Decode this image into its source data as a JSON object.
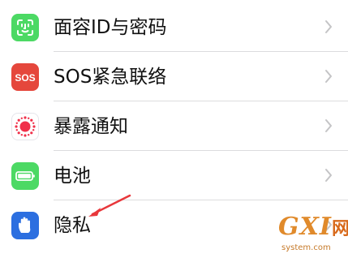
{
  "settings_rows": [
    {
      "label": "面容ID与密码",
      "icon": "face-id-icon",
      "color": "#4cd964"
    },
    {
      "label": "SOS紧急联络",
      "icon": "sos-icon",
      "color": "#e5473c",
      "icon_text": "SOS"
    },
    {
      "label": "暴露通知",
      "icon": "exposure-notification-icon",
      "color": "#ffffff"
    },
    {
      "label": "电池",
      "icon": "battery-icon",
      "color": "#4cd964"
    },
    {
      "label": "隐私",
      "icon": "hand-privacy-icon",
      "color": "#2c6fe0"
    }
  ],
  "accent_colors": {
    "arrow": "#e8373b",
    "chevron": "#c4c4c6"
  },
  "watermark": {
    "logo": "GXI",
    "logo_suffix": "网",
    "domain": "system.com"
  }
}
